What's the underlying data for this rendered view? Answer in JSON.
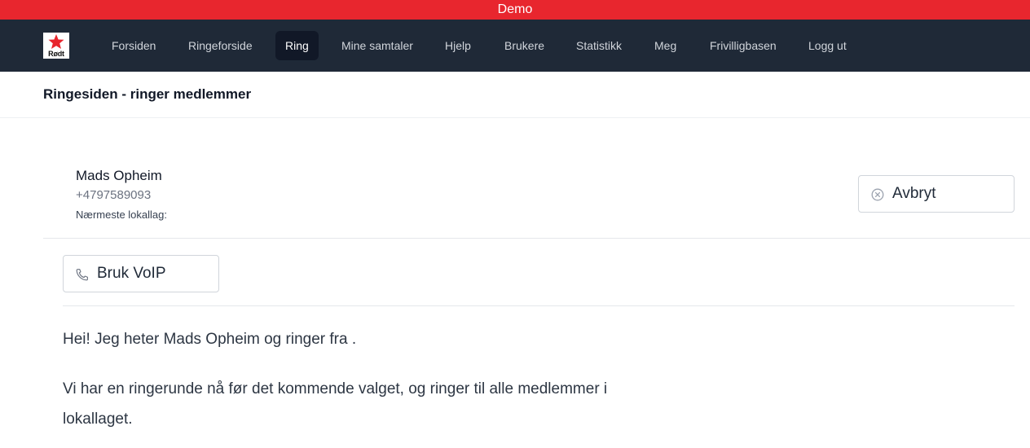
{
  "banner": {
    "text": "Demo"
  },
  "logo": {
    "text": "Rødt"
  },
  "nav": {
    "items": [
      {
        "label": "Forsiden",
        "active": false
      },
      {
        "label": "Ringeforside",
        "active": false
      },
      {
        "label": "Ring",
        "active": true
      },
      {
        "label": "Mine samtaler",
        "active": false
      },
      {
        "label": "Hjelp",
        "active": false
      },
      {
        "label": "Brukere",
        "active": false
      },
      {
        "label": "Statistikk",
        "active": false
      },
      {
        "label": "Meg",
        "active": false
      },
      {
        "label": "Frivilligbasen",
        "active": false
      },
      {
        "label": "Logg ut",
        "active": false
      }
    ]
  },
  "page": {
    "title": "Ringesiden - ringer medlemmer"
  },
  "contact": {
    "name": "Mads Opheim",
    "phone": "+4797589093",
    "local_branch_label": "Nærmeste lokallag:"
  },
  "actions": {
    "cancel_label": "Avbryt",
    "cancel_icon": "x-circle-icon",
    "voip_label": "Bruk VoIP",
    "voip_icon": "phone-icon"
  },
  "script": {
    "paragraph_1": "Hei! Jeg heter Mads Opheim og ringer fra .",
    "paragraph_2_line_1": "Vi har en ringerunde nå før det kommende valget, og ringer til alle medlemmer i",
    "paragraph_2_line_2": "lokallaget."
  },
  "colors": {
    "banner": "#e8262e",
    "navbar": "#1f2937",
    "nav_active": "#111827"
  }
}
